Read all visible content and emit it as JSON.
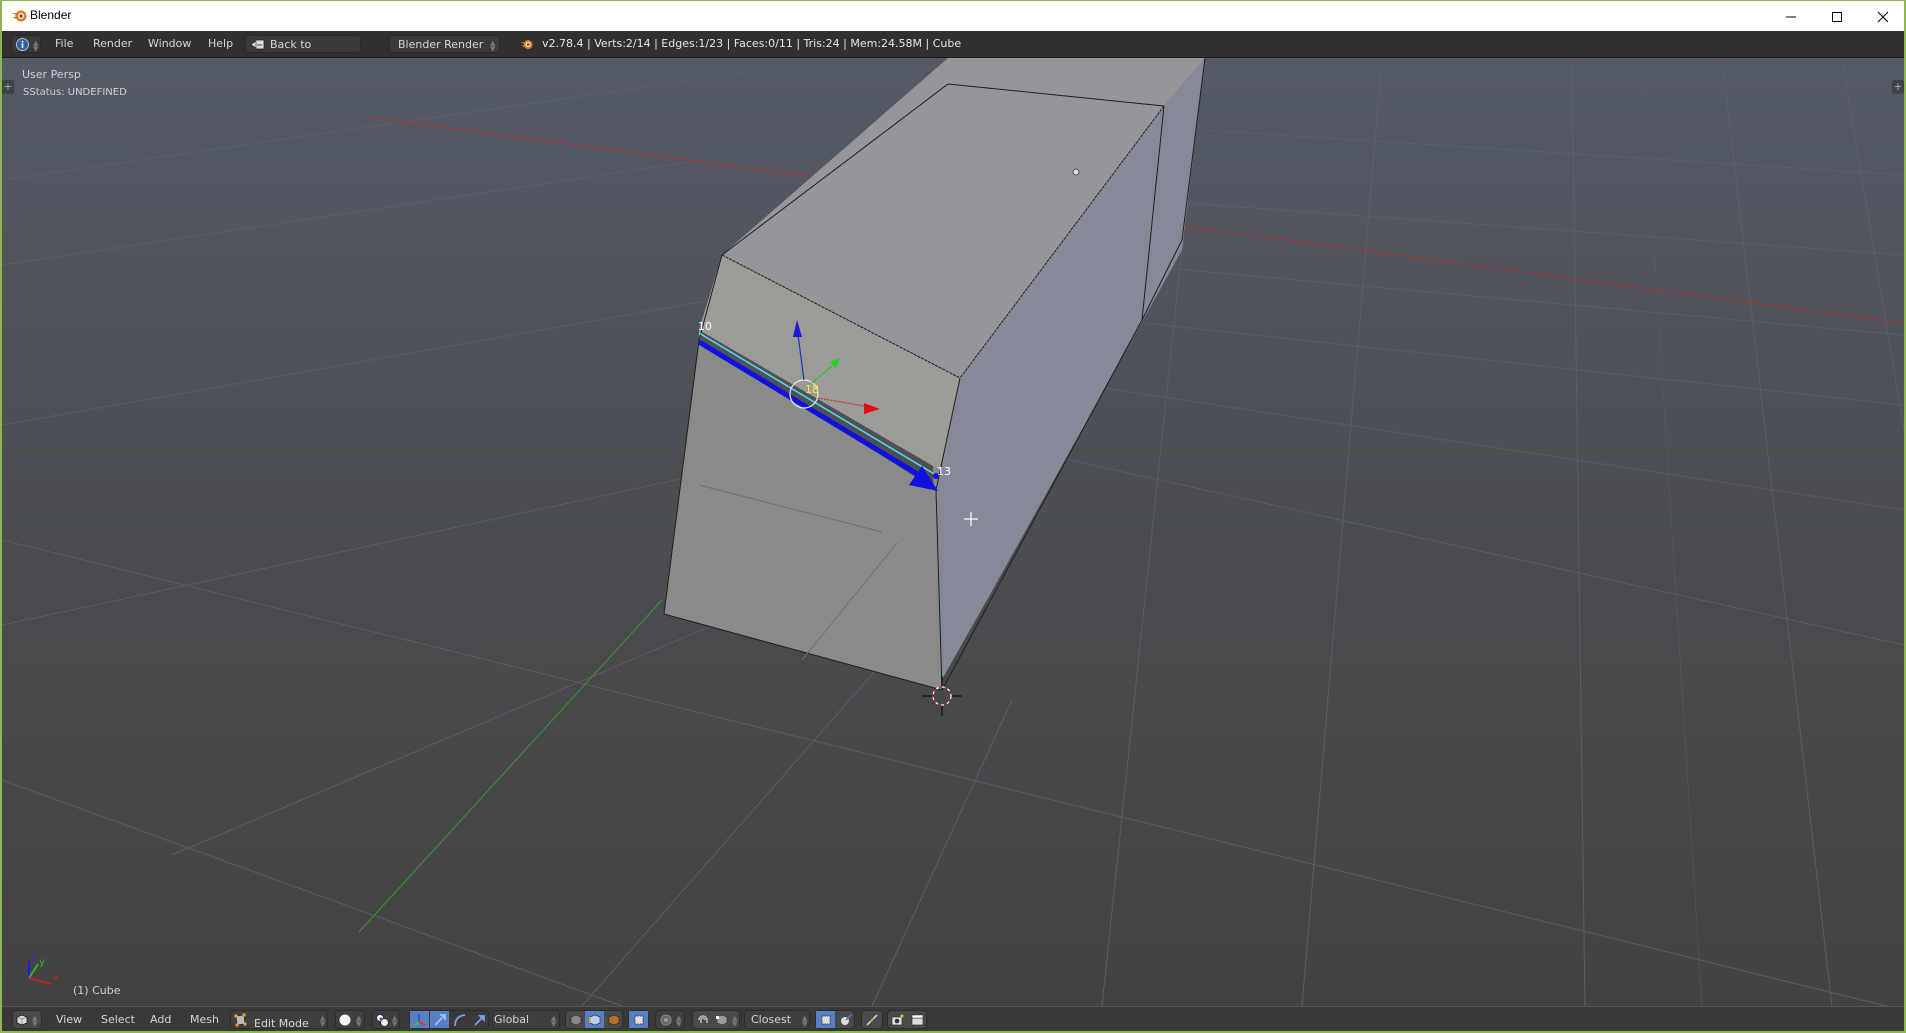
{
  "window": {
    "title": "Blender",
    "controls": [
      "minimize",
      "maximize",
      "close"
    ]
  },
  "header": {
    "editor_type_icon": "info-icon",
    "menus": [
      "File",
      "Render",
      "Window",
      "Help"
    ],
    "back_button": "Back to Previous",
    "render_engine": "Blender Render",
    "stats": "v2.78.4 | Verts:2/14 | Edges:1/23 | Faces:0/11 | Tris:24 | Mem:24.58M | Cube"
  },
  "viewport": {
    "view_name": "User Persp",
    "status_text": "SStatus: UNDEFINED",
    "object_label": "(1) Cube",
    "axis_labels": {
      "x": "x",
      "y": "y",
      "z": "z"
    },
    "vertex_labels": {
      "v10": "10",
      "v13": "13",
      "edge": "18"
    },
    "colors": {
      "x_axis": "#c03030",
      "y_axis": "#3a9a2a",
      "z_axis": "#2030c0",
      "selected_edge": "#55dfe8",
      "normal_arrow": "#1010e0",
      "edge_index": "#f0f030"
    }
  },
  "footer": {
    "editor_type_icon": "cube-icon",
    "menus": [
      "View",
      "Select",
      "Add",
      "Mesh"
    ],
    "mode": "Edit Mode",
    "orientation": "Global",
    "snap_target": "Closest",
    "accent": "#5680c2"
  }
}
